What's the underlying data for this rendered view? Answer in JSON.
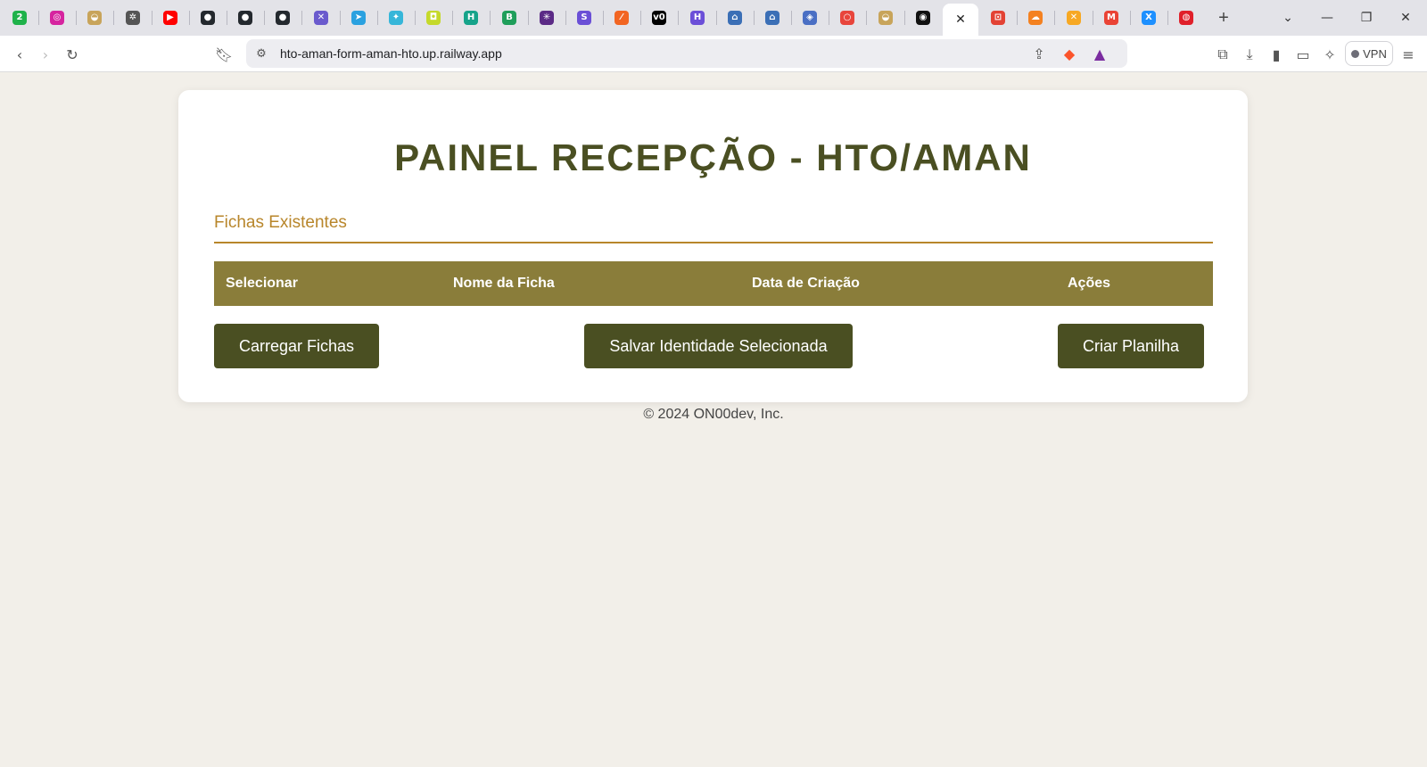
{
  "browser": {
    "tabs": [
      {
        "icon": "green-2-icon",
        "glyph": "2",
        "color": "#1fb24a"
      },
      {
        "icon": "instagram-icon",
        "glyph": "◎",
        "color": "#d6249f"
      },
      {
        "icon": "bowl-icon",
        "glyph": "◒",
        "color": "#c8a45a"
      },
      {
        "icon": "openai-icon",
        "glyph": "✲",
        "color": "#555555"
      },
      {
        "icon": "youtube-icon",
        "glyph": "▶",
        "color": "#ff0000"
      },
      {
        "icon": "github-icon",
        "glyph": "●",
        "color": "#24292e"
      },
      {
        "icon": "github-icon",
        "glyph": "●",
        "color": "#24292e"
      },
      {
        "icon": "github-icon",
        "glyph": "●",
        "color": "#24292e"
      },
      {
        "icon": "cross-icon",
        "glyph": "✕",
        "color": "#6a5acd"
      },
      {
        "icon": "telegram-icon",
        "glyph": "➤",
        "color": "#2aa1e0"
      },
      {
        "icon": "arrow-icon",
        "glyph": "✦",
        "color": "#36b6d9"
      },
      {
        "icon": "robot-icon",
        "glyph": "◘",
        "color": "#c5d92b"
      },
      {
        "icon": "h-icon",
        "glyph": "H",
        "color": "#16a38a"
      },
      {
        "icon": "b-icon",
        "glyph": "B",
        "color": "#1f9e5a"
      },
      {
        "icon": "star-icon",
        "glyph": "✳",
        "color": "#5b2a86"
      },
      {
        "icon": "s-icon",
        "glyph": "S",
        "color": "#6a4fd6"
      },
      {
        "icon": "slash-icon",
        "glyph": "⁄",
        "color": "#f26522"
      },
      {
        "icon": "vercel-icon",
        "glyph": "v0",
        "color": "#000000"
      },
      {
        "icon": "h-purple-icon",
        "glyph": "H",
        "color": "#6b4fd8"
      },
      {
        "icon": "house-icon",
        "glyph": "⌂",
        "color": "#3b6fb6"
      },
      {
        "icon": "house-icon",
        "glyph": "⌂",
        "color": "#3b6fb6"
      },
      {
        "icon": "shield-icon",
        "glyph": "◈",
        "color": "#4a6fc4"
      },
      {
        "icon": "ring-icon",
        "glyph": "○",
        "color": "#e8453c"
      },
      {
        "icon": "bowl-icon",
        "glyph": "◒",
        "color": "#c8a45a"
      },
      {
        "icon": "mask-icon",
        "glyph": "◉",
        "color": "#111111"
      },
      {
        "icon": "close-icon",
        "glyph": "✕",
        "color": "#222222",
        "active": true
      },
      {
        "icon": "lock-icon",
        "glyph": "⊡",
        "color": "#e34234"
      },
      {
        "icon": "cloudflare-icon",
        "glyph": "☁",
        "color": "#f48120"
      },
      {
        "icon": "x-orange-icon",
        "glyph": "✕",
        "color": "#f7a823"
      },
      {
        "icon": "gmail-icon",
        "glyph": "M",
        "color": "#ea4335"
      },
      {
        "icon": "x-blue-icon",
        "glyph": "X",
        "color": "#1e90ff"
      },
      {
        "icon": "circle-icon",
        "glyph": "◍",
        "color": "#e0202a"
      }
    ],
    "new_tab_label": "+",
    "url": "hto-aman-form-aman-hto.up.railway.app",
    "vpn_label": "VPN"
  },
  "page": {
    "title": "PAINEL RECEPÇÃO - HTO/AMAN",
    "section_title": "Fichas Existentes",
    "table_headers": [
      "Selecionar",
      "Nome da Ficha",
      "Data de Criação",
      "Ações"
    ],
    "buttons": {
      "load": "Carregar Fichas",
      "save": "Salvar Identidade Selecionada",
      "create": "Criar Planilha"
    },
    "footer": "© 2024 ON00dev, Inc."
  },
  "colors": {
    "title": "#4a4f22",
    "accent": "#b8862b",
    "table_header": "#8a7d3a",
    "button": "#4a4f22",
    "page_bg": "#f2efe9"
  }
}
